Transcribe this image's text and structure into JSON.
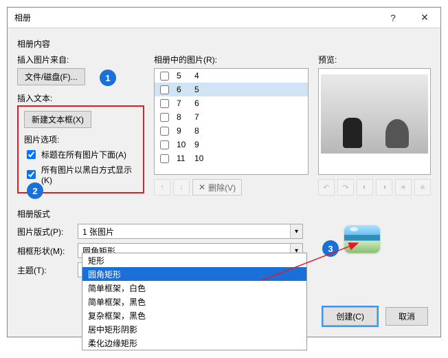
{
  "title": "相册",
  "sections": {
    "content_label": "相册内容",
    "insert_from_label": "插入图片来自:",
    "file_disk_button": "文件/磁盘(F)...",
    "insert_text_label": "插入文本:",
    "new_textbox_button": "新建文本框(X)",
    "image_options_label": "图片选项:",
    "caption_below_label": "标题在所有图片下面(A)",
    "all_bw_label": "所有图片以黑白方式显示(K)"
  },
  "list": {
    "header": "相册中的图片(R):",
    "rows": [
      {
        "n": "5",
        "v": "4",
        "checked": false,
        "sel": false
      },
      {
        "n": "6",
        "v": "5",
        "checked": false,
        "sel": true
      },
      {
        "n": "7",
        "v": "6",
        "checked": false,
        "sel": false
      },
      {
        "n": "8",
        "v": "7",
        "checked": false,
        "sel": false
      },
      {
        "n": "9",
        "v": "8",
        "checked": false,
        "sel": false
      },
      {
        "n": "10",
        "v": "9",
        "checked": false,
        "sel": false
      },
      {
        "n": "11",
        "v": "10",
        "checked": false,
        "sel": false
      }
    ],
    "delete_label": "删除(V)"
  },
  "preview": {
    "header": "预览:"
  },
  "layout_section": {
    "header": "相册版式",
    "pic_layout_label": "图片版式(P):",
    "pic_layout_value": "1 张图片",
    "frame_shape_label": "相框形状(M):",
    "frame_shape_value": "圆角矩形",
    "theme_label": "主题(T):",
    "theme_value": ""
  },
  "dropdown": {
    "options": [
      "矩形",
      "圆角矩形",
      "简单框架，白色",
      "简单框架，黑色",
      "复杂框架，黑色",
      "居中矩形阴影",
      "柔化边缘矩形"
    ],
    "selected_index": 1
  },
  "buttons": {
    "create": "创建(C)",
    "cancel": "取消"
  },
  "badges": {
    "b1": "1",
    "b2": "2",
    "b3": "3"
  },
  "titlebar_icons": {
    "help": "?",
    "close": "✕"
  },
  "chk_states": {
    "caption_below": true,
    "all_bw": true
  }
}
